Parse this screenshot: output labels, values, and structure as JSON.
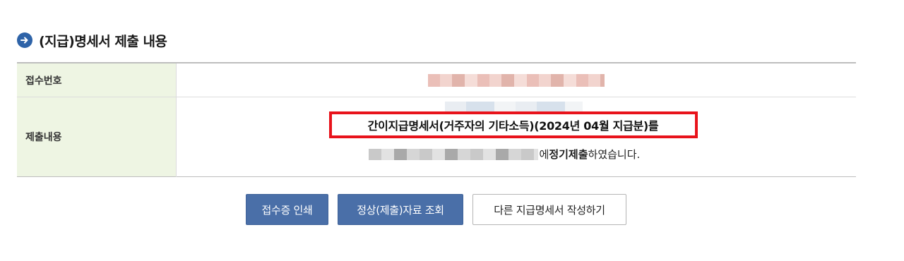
{
  "section": {
    "title": "(지급)명세서 제출 내용",
    "icon": "arrow-right-circle-icon"
  },
  "table": {
    "receipt_label": "접수번호",
    "content_label": "제출내용",
    "content_main": "간이지급명세서(거주자의 기타소득)(2024년 04월 지급분)를",
    "content_suffix_1": "에 ",
    "content_bold": "정기제출",
    "content_suffix_2": " 하였습니다."
  },
  "buttons": {
    "print_label": "접수증 인쇄",
    "view_label": "정상(제출)자료 조회",
    "write_label": "다른 지급명세서 작성하기"
  },
  "colors": {
    "accent_blue": "#4a6fa8",
    "header_bg": "#eef5e3",
    "highlight_red": "#e8131b"
  }
}
